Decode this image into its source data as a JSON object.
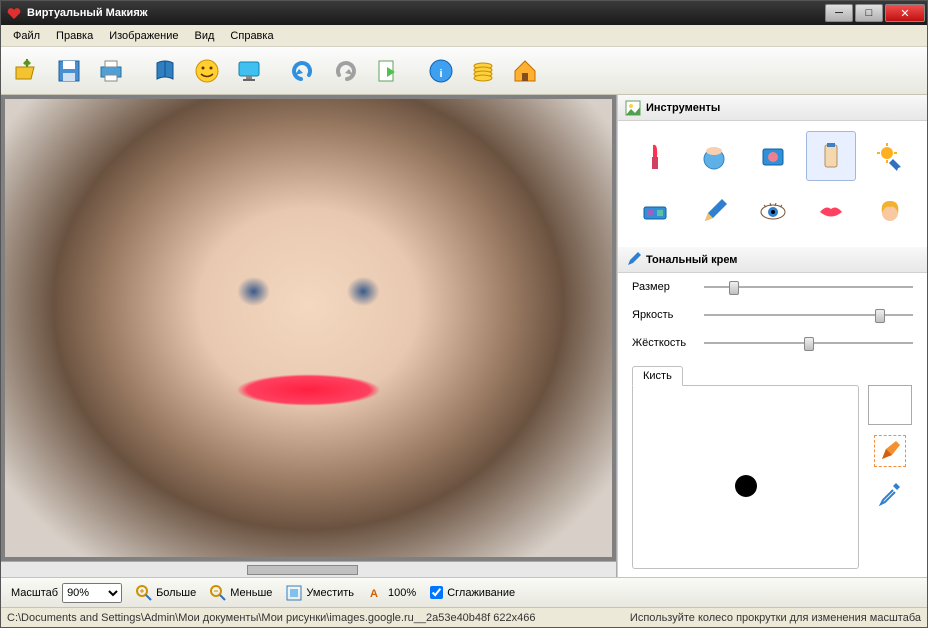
{
  "window": {
    "title": "Виртуальный Макияж"
  },
  "menu": {
    "file": "Файл",
    "edit": "Правка",
    "image": "Изображение",
    "view": "Вид",
    "help": "Справка"
  },
  "toolbar_icons": [
    "open",
    "save",
    "print",
    "history",
    "smiley",
    "display",
    "undo",
    "redo",
    "export",
    "info",
    "coins",
    "home"
  ],
  "panels": {
    "tools_title": "Инструменты",
    "section_title": "Тональный крем",
    "sliders": {
      "size": "Размер",
      "brightness": "Яркость",
      "hardness": "Жёсткость"
    },
    "slider_pos": {
      "size": 12,
      "brightness": 82,
      "hardness": 48
    },
    "brush_tab": "Кисть"
  },
  "tools": [
    {
      "name": "lipstick"
    },
    {
      "name": "powder"
    },
    {
      "name": "blush"
    },
    {
      "name": "foundation",
      "selected": true
    },
    {
      "name": "sun"
    },
    {
      "name": "eyeshadow"
    },
    {
      "name": "pencil"
    },
    {
      "name": "eye"
    },
    {
      "name": "lips"
    },
    {
      "name": "hair"
    }
  ],
  "bottom": {
    "zoom_label": "Масштаб",
    "zoom_value": "90%",
    "bigger": "Больше",
    "smaller": "Меньше",
    "fit": "Уместить",
    "hundred": "100%",
    "smooth": "Сглаживание",
    "smooth_checked": true
  },
  "status": {
    "path": "C:\\Documents and Settings\\Admin\\Мои документы\\Мои рисунки\\images.google.ru__2a53e40b48f 622x466",
    "hint": "Используйте колесо прокрутки для изменения масштаба"
  }
}
